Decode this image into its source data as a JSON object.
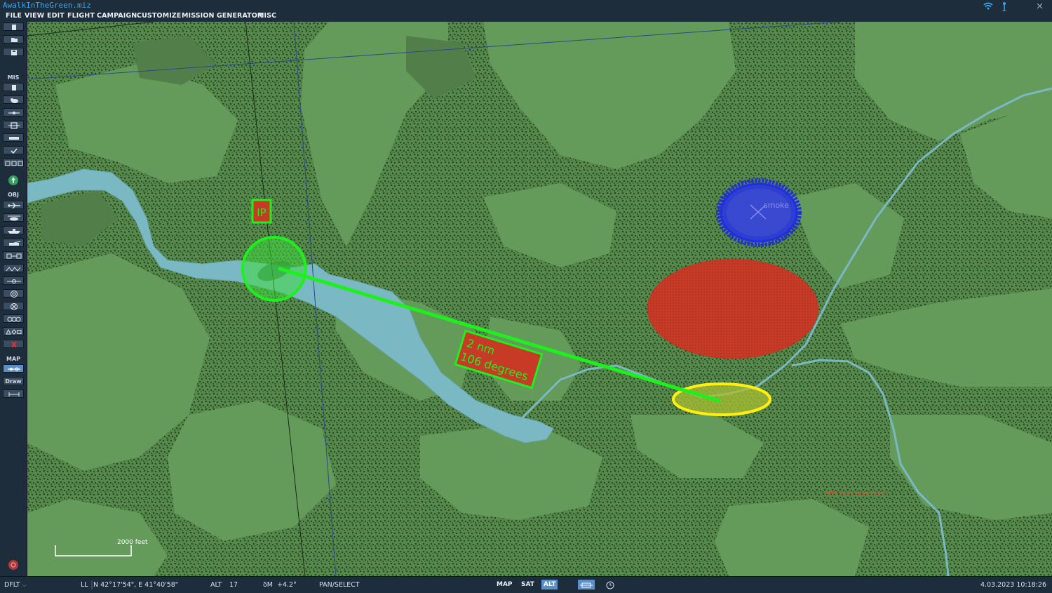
{
  "window": {
    "title": "AwalkInTheGreen.miz"
  },
  "menu": [
    "FILE",
    "VIEW",
    "EDIT",
    "FLIGHT",
    "CAMPAIGN",
    "CUSTOMIZE",
    "MISSION GENERATOR",
    "MISC"
  ],
  "sidebar": {
    "mis_label": "MIS",
    "obj_label": "OBJ",
    "map_label": "MAP",
    "draw_label": "Draw"
  },
  "map": {
    "ip_label": "IP",
    "measure_distance": "2 nm",
    "measure_bearing": "106 degrees",
    "smoke_label": "smoke",
    "srs_status": "SRS not connected",
    "scale_label": "2000 feet"
  },
  "statusbar": {
    "profile": "DFLT",
    "coord_label": "LL",
    "coords": "N 42°17'54\", E 41°40'58\"",
    "alt_label": "ALT",
    "alt_value": "17",
    "magvar_label": "δM",
    "magvar_value": "+4.2°",
    "mode": "PAN/SELECT",
    "view_buttons": [
      "MAP",
      "SAT",
      "ALT"
    ],
    "active_view": "ALT",
    "datetime": "4.03.2023 10:18:26"
  },
  "colors": {
    "terrain_light": "#649a5a",
    "terrain_dark": "#56894e",
    "forest_dots": "#2c4a1e",
    "water": "#7ab8c4",
    "route_green": "#1ef01e",
    "red_zone": "#c63a26",
    "blue_zone": "#1e2ee0",
    "yellow_zone": "#ffee10",
    "accent_blue": "#36a9ef"
  }
}
